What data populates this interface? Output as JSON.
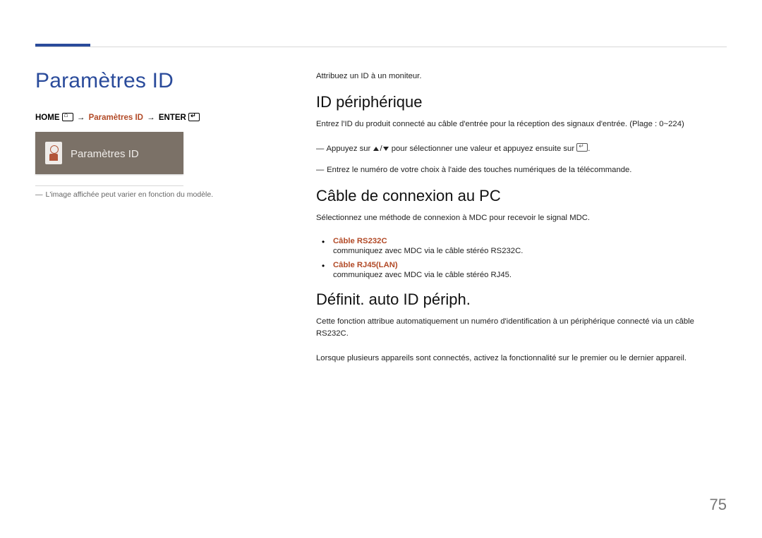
{
  "page": {
    "title": "Paramètres ID",
    "number": "75"
  },
  "nav": {
    "home": "HOME",
    "arrow": "→",
    "param": "Paramètres ID",
    "enter": "ENTER"
  },
  "mini": {
    "label": "Paramètres ID"
  },
  "left_note": "L'image affichée peut varier en fonction du modèle.",
  "right": {
    "intro": "Attribuez un ID à un moniteur.",
    "sec1": {
      "heading": "ID périphérique",
      "body": "Entrez l'ID du produit connecté au câble d'entrée pour la réception des signaux d'entrée. (Plage : 0~224)",
      "dash1_pre": "Appuyez sur",
      "dash1_post": "pour sélectionner une valeur et appuyez ensuite sur",
      "dash1_end": ".",
      "dash2": "Entrez le numéro de votre choix à l'aide des touches numériques de la télécommande."
    },
    "sec2": {
      "heading": "Câble de connexion au PC",
      "body": "Sélectionnez une méthode de connexion à MDC pour recevoir le signal MDC.",
      "options": [
        {
          "label": "Câble RS232C",
          "desc": "communiquez avec MDC via le câble stéréo RS232C."
        },
        {
          "label": "Câble RJ45(LAN)",
          "desc": "communiquez avec MDC via le câble stéréo RJ45."
        }
      ]
    },
    "sec3": {
      "heading": "Définit. auto ID périph.",
      "body1": "Cette fonction attribue automatiquement un numéro d'identification à un périphérique connecté via un câble RS232C.",
      "body2": "Lorsque plusieurs appareils sont connectés, activez la fonctionnalité sur le premier ou le dernier appareil."
    }
  }
}
